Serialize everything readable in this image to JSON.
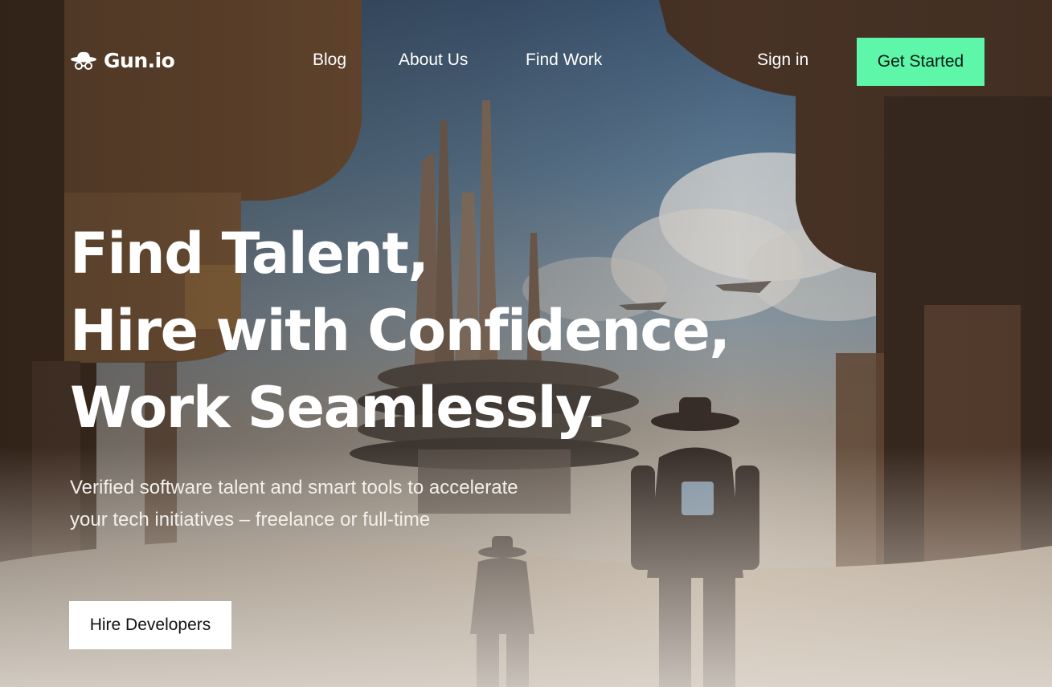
{
  "brand": {
    "name": "Gun.io",
    "icon": "hat-glasses-icon"
  },
  "nav": {
    "links": [
      "Blog",
      "About Us",
      "Find Work"
    ],
    "signin": "Sign in",
    "cta": "Get Started",
    "cta_color": "#5ef6a8"
  },
  "hero": {
    "headline": [
      "Find Talent,",
      "Hire with Confidence,",
      "Work Seamlessly."
    ],
    "subtitle": "Verified software talent and smart tools to accelerate your tech initiatives – freelance or full-time",
    "cta": "Hire Developers"
  }
}
